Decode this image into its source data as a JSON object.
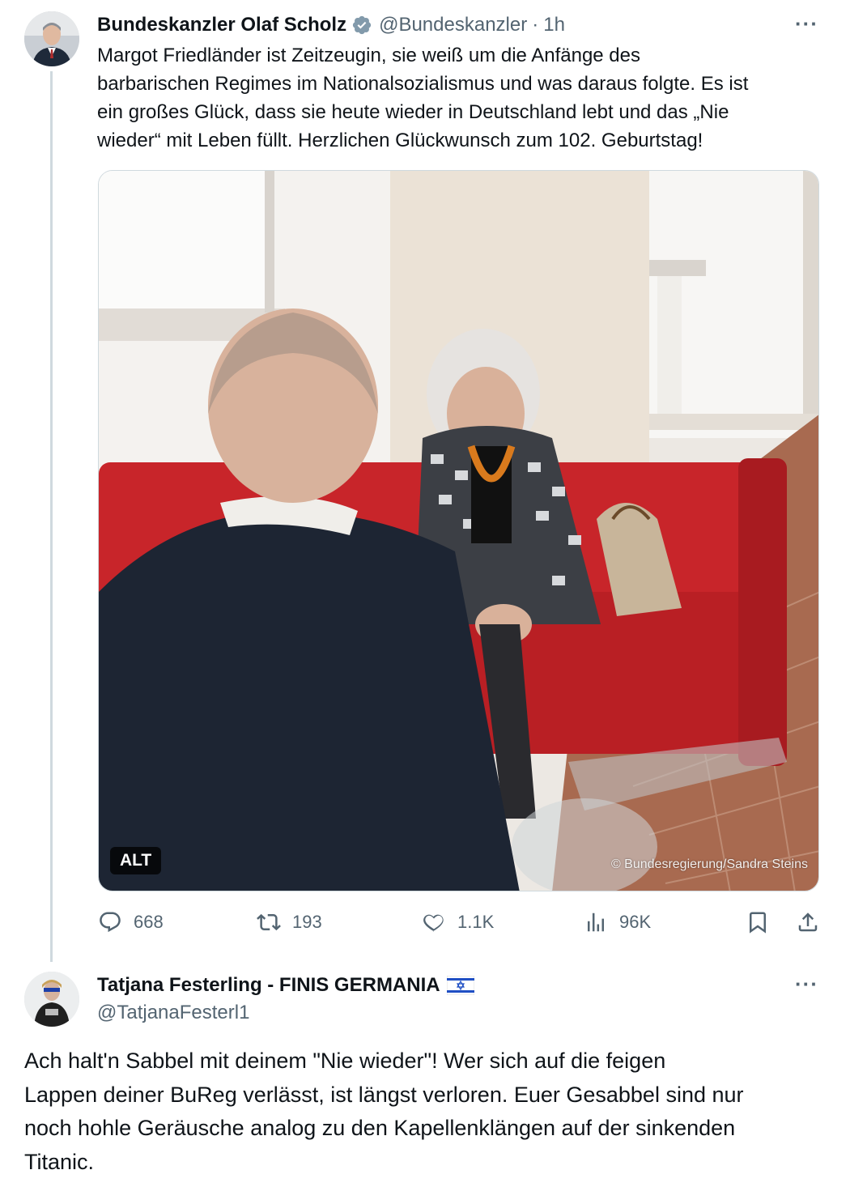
{
  "original_tweet": {
    "author_name": "Bundeskanzler Olaf Scholz",
    "handle": "@Bundeskanzler",
    "separator": "·",
    "time": "1h",
    "more_label": "···",
    "text_lines": [
      "Margot Friedländer ist Zeitzeugin, sie weiß um die Anfänge des",
      "barbarischen Regimes im Nationalsozialismus und was daraus folgte. Es ist",
      "ein großes Glück, dass sie heute wieder in Deutschland lebt und das „Nie",
      "wieder“ mit Leben füllt. Herzlichen Glückwunsch zum 102. Geburtstag!"
    ],
    "media": {
      "alt_badge": "ALT",
      "credit": "© Bundesregierung/Sandra Steins"
    },
    "stats": {
      "replies": "668",
      "retweets": "193",
      "likes": "1.1K",
      "views": "96K"
    }
  },
  "reply_tweet": {
    "author_name": "Tatjana Festerling - FINIS GERMANIA",
    "flag_icon": "israel-flag-icon",
    "handle": "@TatjanaFesterl1",
    "more_label": "···",
    "text_lines": [
      "Ach halt'n Sabbel mit deinem \"Nie wieder\"! Wer sich auf die feigen",
      "Lappen deiner BuReg verlässt, ist längst verloren. Euer Gesabbel sind nur",
      "noch hohle Geräusche analog zu den Kapellenklängen auf der sinkenden",
      "Titanic."
    ]
  },
  "colors": {
    "text_primary": "#0f1419",
    "text_secondary": "#536471",
    "verified_blue": "#829aab",
    "divider": "#cfd9de",
    "sofa_red": "#c8252a"
  }
}
